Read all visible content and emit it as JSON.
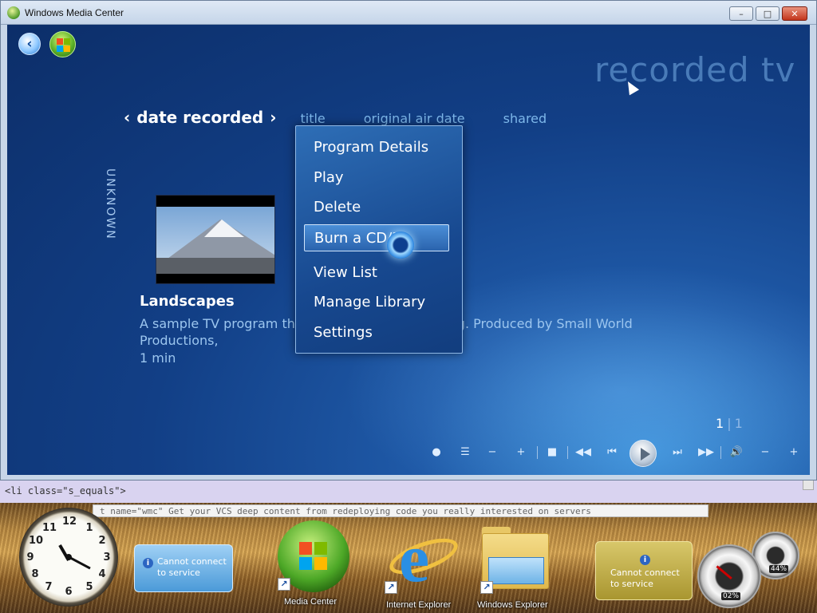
{
  "window": {
    "title": "Windows Media Center",
    "minimize_label": "–",
    "maximize_label": "□",
    "close_label": "✕"
  },
  "media_center": {
    "section_title": "recorded tv",
    "back_icon": "back-arrow-icon",
    "start_icon": "windows-start-icon",
    "sort_tabs": {
      "active": "date recorded",
      "active_prev": "‹",
      "active_next": "›",
      "others": [
        "title",
        "original air date",
        "shared"
      ]
    },
    "group_label": "UNKNOWN",
    "program": {
      "title": "Landscapes",
      "description": "A sample TV program tha                                             n-bike riding, and rafting. Produced by Small World Productions,",
      "duration": "1 min"
    },
    "context_menu": {
      "items": [
        "Program Details",
        "Play",
        "Delete",
        "Burn a CD/D",
        "View List",
        "Manage Library",
        "Settings"
      ],
      "focused_index": 3
    },
    "pager": {
      "current": "1",
      "separator": "|",
      "total": "1"
    },
    "transport": [
      "●",
      "☰",
      "−",
      "+",
      "■",
      "◀◀",
      "⏮",
      "⏭",
      "▶▶",
      "🔊",
      "−",
      "+"
    ]
  },
  "background_page": {
    "strip_text": "<li class=\"s_equals\">",
    "code_text": "t   name=\"wmc\" Get your VCS deep content from redeploying code you really interested on servers"
  },
  "desktop": {
    "clock_numbers": [
      "12",
      "1",
      "2",
      "3",
      "4",
      "5",
      "6",
      "7",
      "8",
      "9",
      "10",
      "11"
    ],
    "weather_gadget": {
      "message": "Cannot connect to service"
    },
    "feed_gadget": {
      "message": "Cannot connect to service"
    },
    "shortcuts": [
      {
        "label": "Media Center"
      },
      {
        "label": "Internet Explorer"
      },
      {
        "label": "Windows Explorer"
      }
    ],
    "meters": {
      "cpu": "02%",
      "memory": "44%"
    }
  },
  "colors": {
    "mc_background": "#123f86",
    "menu_highlight": "#4b8fd8",
    "title_watermark": "#78afe6"
  }
}
